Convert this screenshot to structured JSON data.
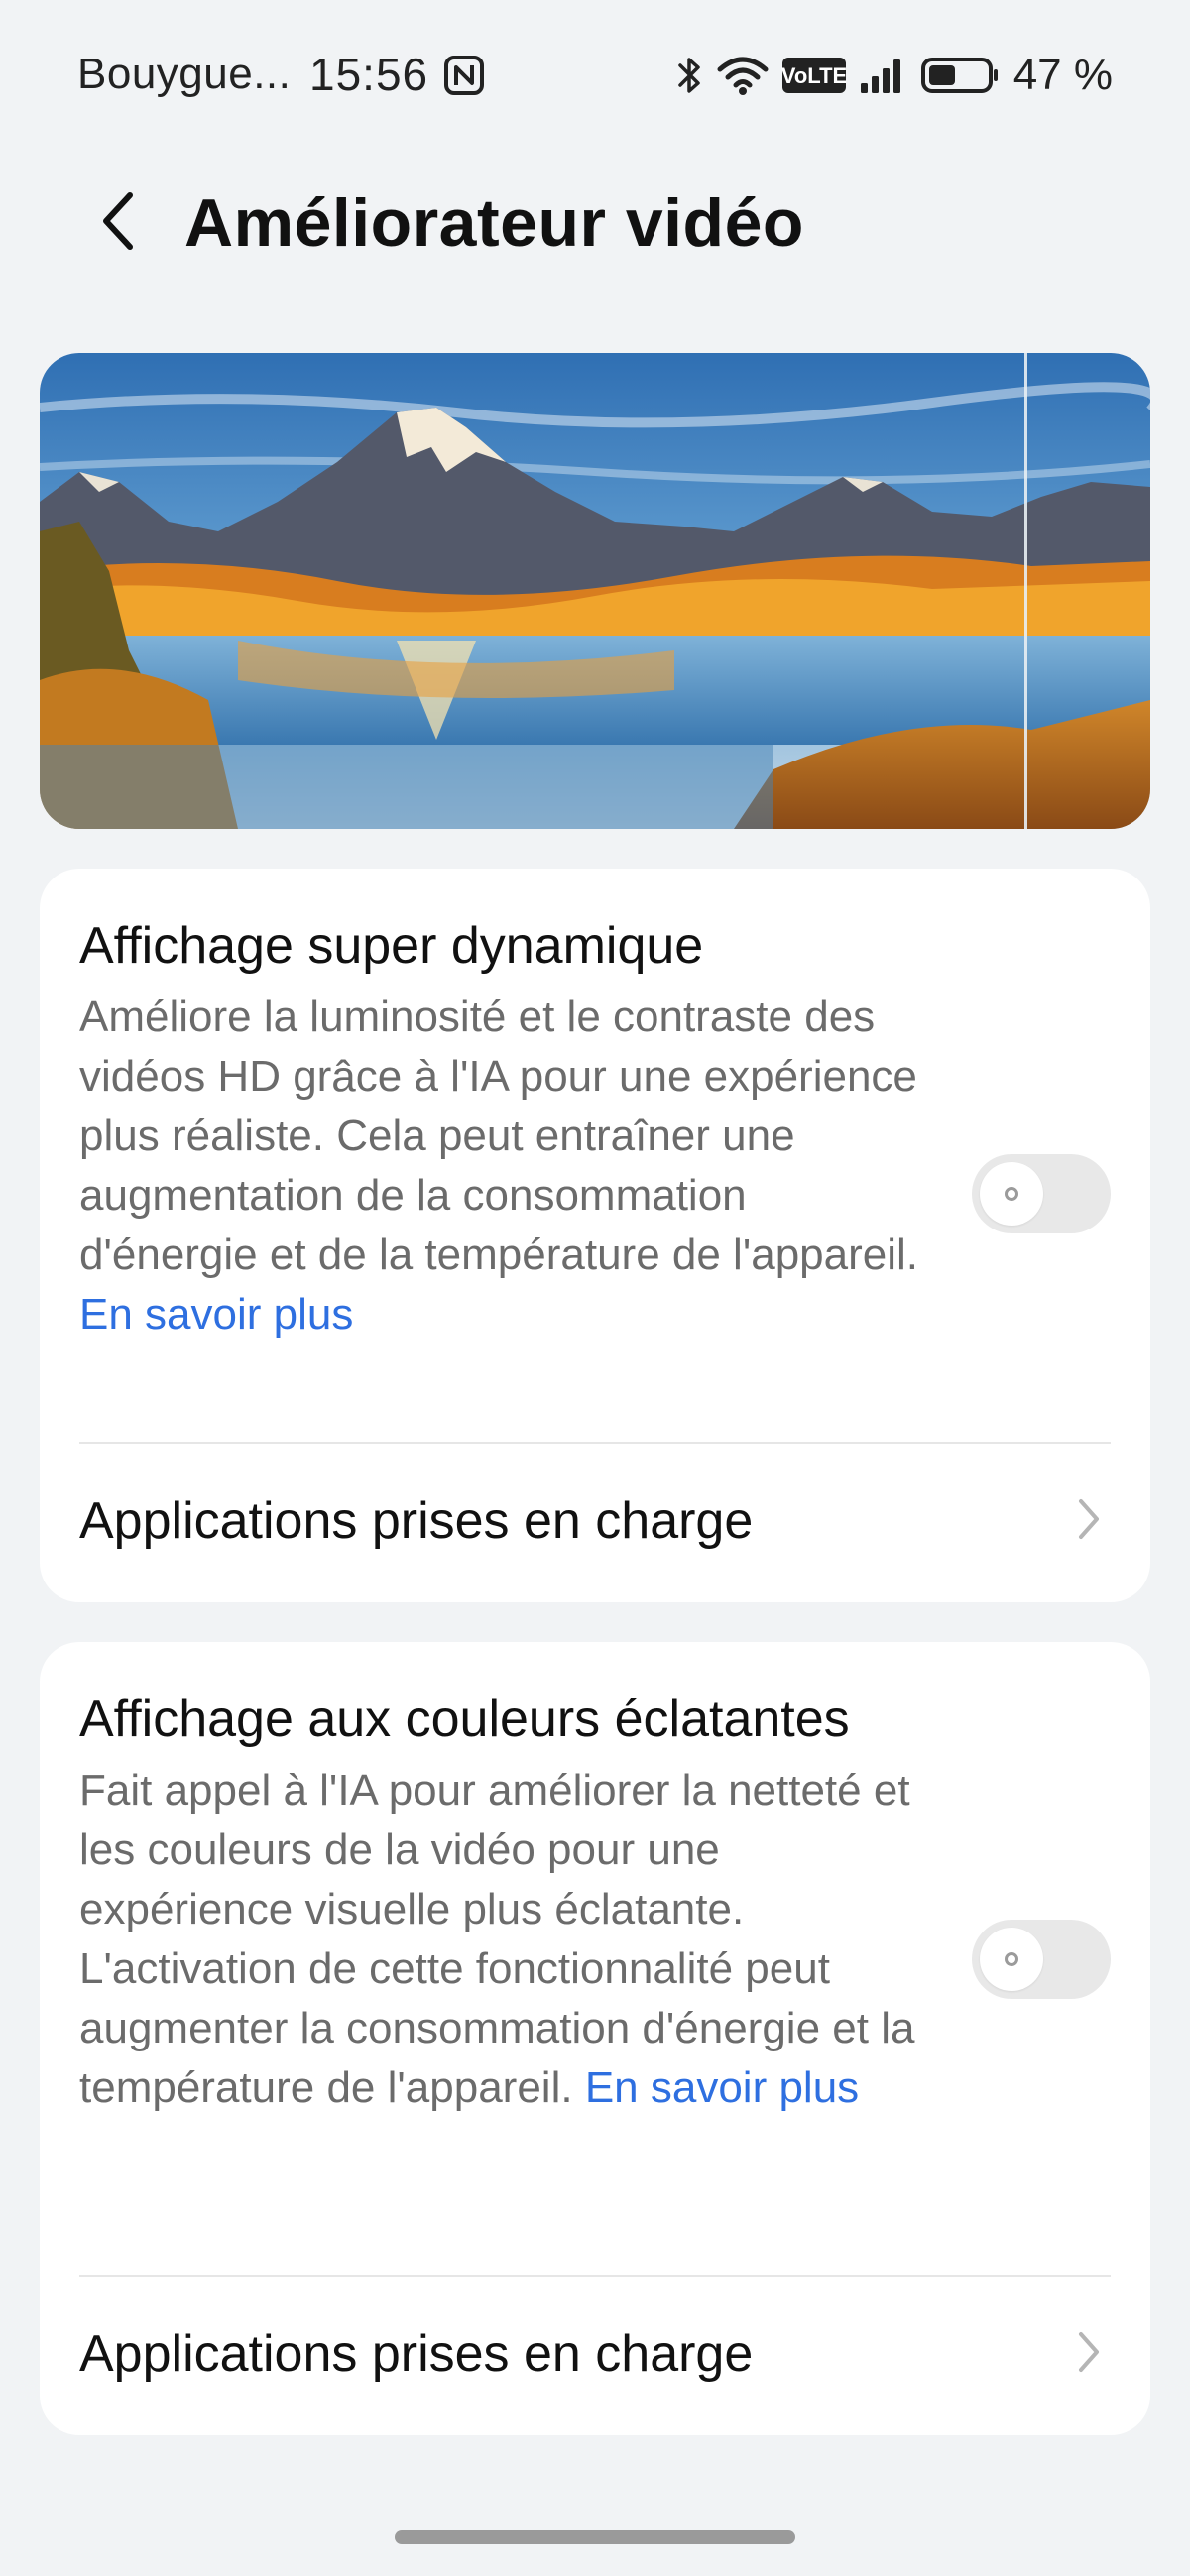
{
  "status_bar": {
    "carrier": "Bouygue...",
    "time": "15:56",
    "volte_label": "VoLTE",
    "battery_percent": "47 %",
    "battery_level": 0.47,
    "icons": [
      "nfc-icon",
      "bluetooth-icon",
      "wifi-icon",
      "volte-icon",
      "signal-icon",
      "battery-icon"
    ]
  },
  "header": {
    "title": "Améliorateur vidéo",
    "back_icon": "back-arrow-icon"
  },
  "banner": {
    "image": "mountain-lake-autumn-landscape"
  },
  "sections": [
    {
      "title": "Affichage super dynamique",
      "description": "Améliore la luminosité et le contraste des vidéos HD grâce à l'IA pour une expérience plus réaliste. Cela peut entraîner une augmentation de la consommation d'énergie et de la température de l'appareil.",
      "learn_more": "En savoir plus",
      "enabled": false,
      "link_label": "Applications prises en charge"
    },
    {
      "title": "Affichage aux couleurs éclatantes",
      "description": "Fait appel à l'IA pour améliorer la netteté et les couleurs de la vidéo pour une expérience visuelle plus éclatante. L'activation de cette fonctionnalité peut augmenter la consommation d'énergie et la température de l'appareil.",
      "learn_more": "En savoir plus",
      "enabled": false,
      "link_label": "Applications prises en charge"
    }
  ],
  "colors": {
    "background": "#f1f3f5",
    "card": "#ffffff",
    "link": "#2e6fe0",
    "secondary_text": "#6b6b6b",
    "toggle_off": "#e8e8e8"
  }
}
